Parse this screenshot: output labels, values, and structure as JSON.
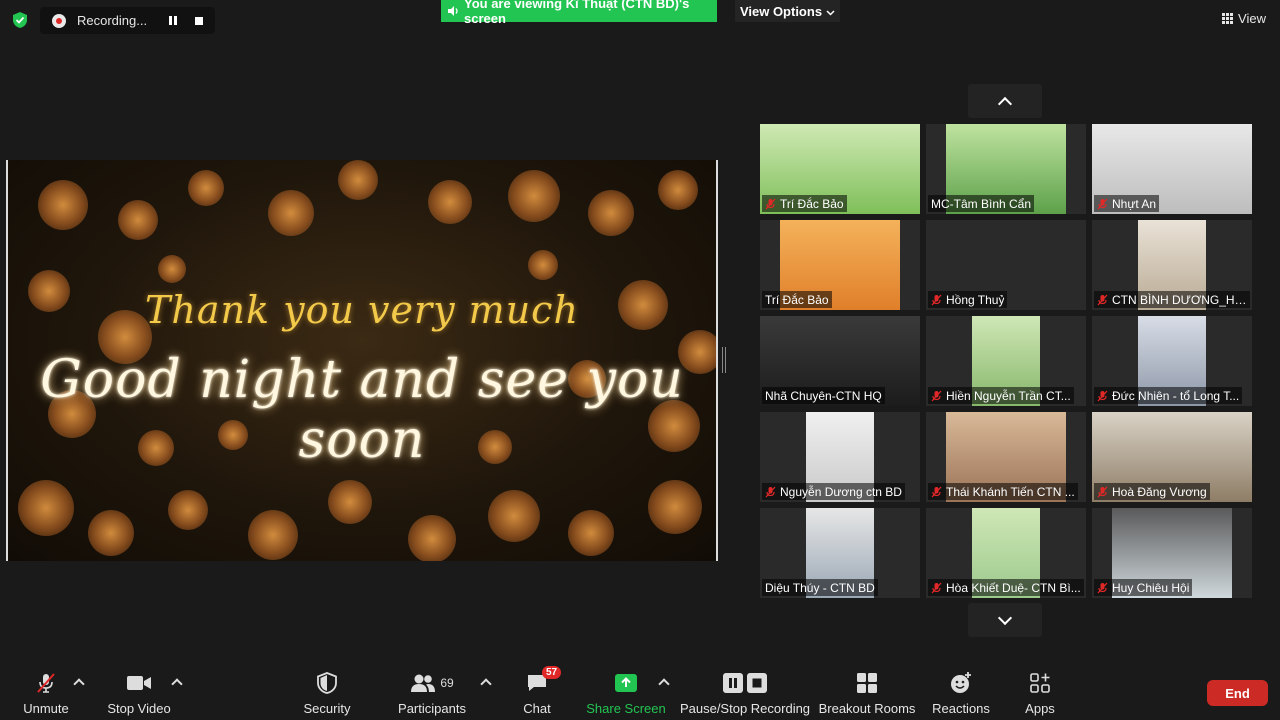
{
  "topbar": {
    "recording_label": "Recording...",
    "viewing_banner": "You are viewing Kĩ Thuật (CTN BD)'s screen",
    "view_options_label": "View Options",
    "view_label": "View"
  },
  "shared_screen": {
    "line1": "Thank you very much",
    "line2": "Good night and see you soon"
  },
  "participants": [
    {
      "name": "Trí Đắc Bảo",
      "muted": true
    },
    {
      "name": "MC-Tâm Bình Cẩn",
      "muted": false
    },
    {
      "name": "Nhựt An",
      "muted": true
    },
    {
      "name": "Trí Đắc Bảo",
      "muted": false
    },
    {
      "name": "Hồng Thuỷ",
      "muted": true
    },
    {
      "name": "CTN BÌNH DƯƠNG_HI...",
      "muted": true
    },
    {
      "name": "Nhã Chuyên-CTN HQ",
      "muted": false
    },
    {
      "name": "Hiền Nguyễn Trần CT...",
      "muted": true
    },
    {
      "name": "Đức Nhiên - tổ Long T...",
      "muted": true
    },
    {
      "name": "Nguyễn Dương ctn BD",
      "muted": true
    },
    {
      "name": "Thái Khánh Tiến CTN ...",
      "muted": true
    },
    {
      "name": "Hoà Đăng Vương",
      "muted": true
    },
    {
      "name": "Diệu Thúy - CTN BD",
      "muted": false
    },
    {
      "name": "Hòa Khiết Duệ- CTN Bì...",
      "muted": true
    },
    {
      "name": "Huy Chiêu Hội",
      "muted": true
    }
  ],
  "toolbar": {
    "unmute": "Unmute",
    "stop_video": "Stop Video",
    "security": "Security",
    "participants": "Participants",
    "participants_count": "69",
    "chat": "Chat",
    "chat_badge": "57",
    "share_screen": "Share Screen",
    "pause_stop_recording": "Pause/Stop Recording",
    "breakout_rooms": "Breakout Rooms",
    "reactions": "Reactions",
    "apps": "Apps",
    "end": "End"
  },
  "colors": {
    "share_green": "#23c552",
    "end_red": "#cc2b25",
    "mute_red": "#e02828",
    "background": "#1a1a1a"
  }
}
